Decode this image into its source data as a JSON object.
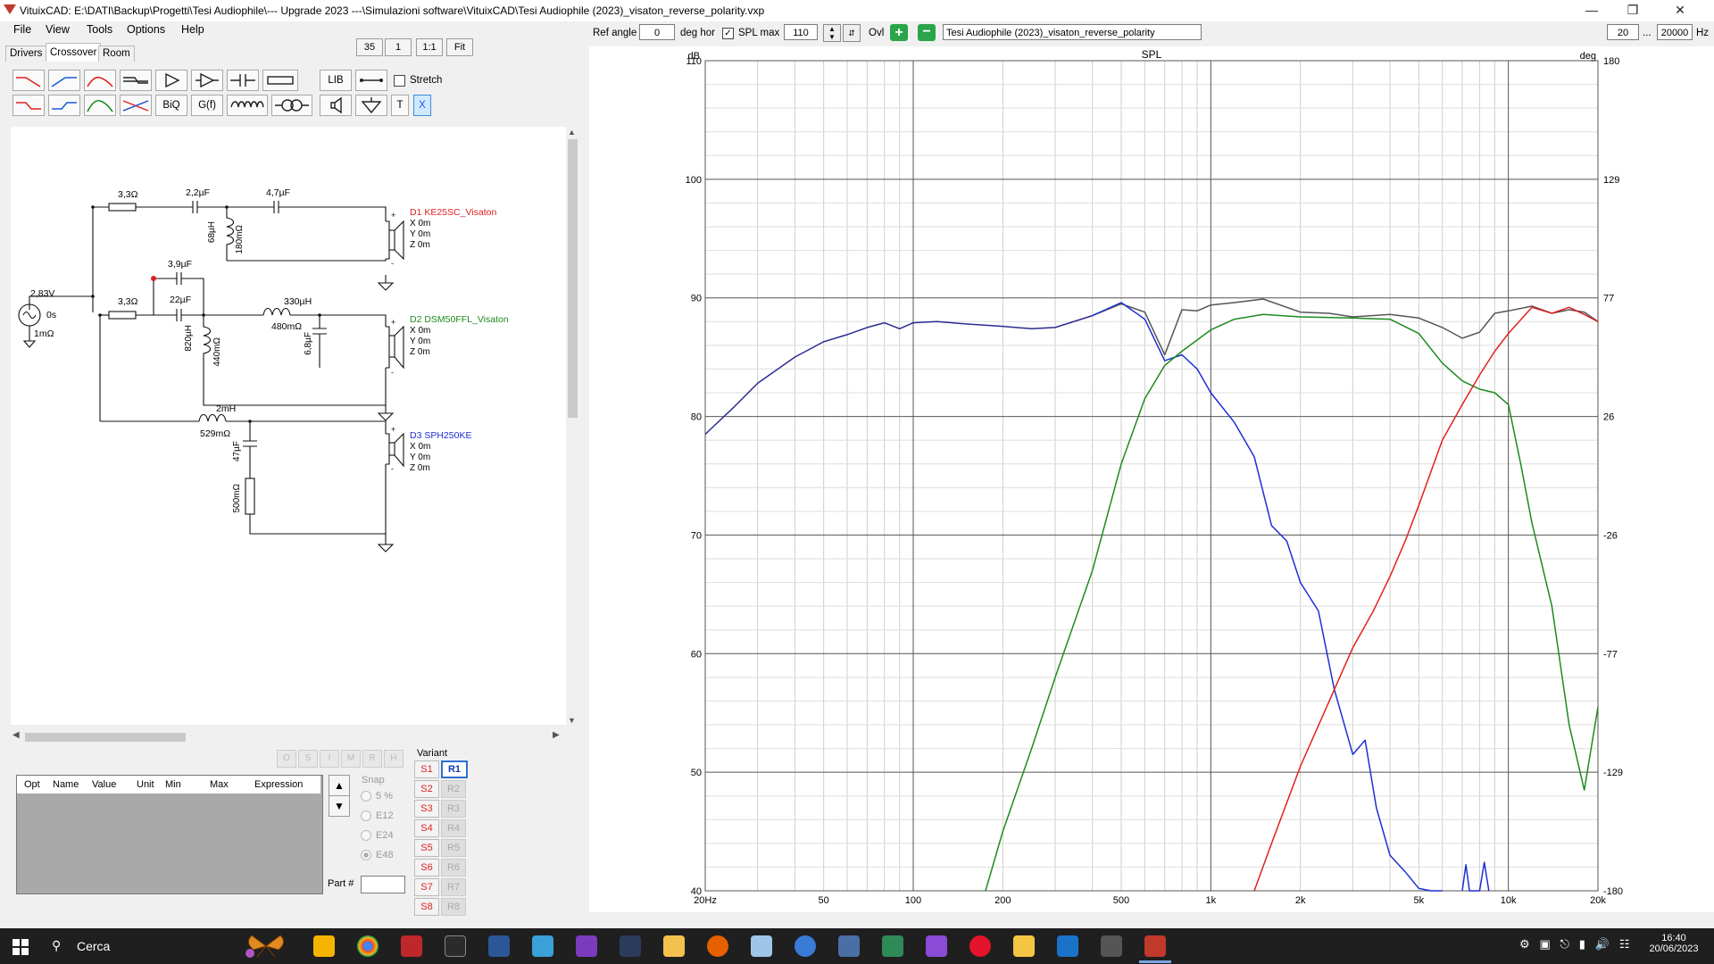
{
  "window": {
    "title": "VituixCAD: E:\\DATI\\Backup\\Progetti\\Tesi Audiophile\\--- Upgrade 2023 ---\\Simulazioni software\\VituixCAD\\Tesi Audiophile (2023)_visaton_reverse_polarity.vxp"
  },
  "menu": [
    "File",
    "View",
    "Tools",
    "Options",
    "Help"
  ],
  "tabs": [
    "Drivers",
    "Crossover",
    "Room"
  ],
  "toolbar": {
    "zoom_value": "35",
    "zoom_step": "1",
    "one_to_one": "1:1",
    "fit": "Fit",
    "lib_label": "LIB",
    "biq_label": "BiQ",
    "gf_label": "G(f)",
    "t_label": "T",
    "x_label": "X",
    "stretch_label": "Stretch"
  },
  "graph_toolbar": {
    "ref_angle_label": "Ref angle",
    "ref_angle_value": "0",
    "deg_hor_label": "deg hor",
    "spl_max_label": "SPL max",
    "spl_max_value": "110",
    "ovl_label": "Ovl",
    "overlay_name": "Tesi Audiophile (2023)_visaton_reverse_polarity",
    "freq_min": "20",
    "freq_sep": "...",
    "freq_max": "20000",
    "hz_label": "Hz"
  },
  "schematic": {
    "source": {
      "voltage": "2,83V",
      "delay": "0s",
      "impedance": "1mΩ"
    },
    "components": {
      "r_tw": "3,3Ω",
      "c_tw1": "2,2µF",
      "c_tw2": "4,7µF",
      "l_tw": "68µH",
      "r_ltw": "180mΩ",
      "c_mid_par": "3,9µF",
      "r_mid": "3,3Ω",
      "c_mid": "22µF",
      "l_mid_ser": "330µH",
      "r_lmid_ser": "480mΩ",
      "l_mid_sh": "820µH",
      "r_lmid_sh": "440mΩ",
      "c_mid_sh": "6,8µF",
      "l_woof": "2mH",
      "r_lwoof": "529mΩ",
      "c_woof": "47µF",
      "r_woof": "500mΩ"
    },
    "drivers": [
      {
        "name": "D1 KE25SC_Visaton",
        "x": "X 0m",
        "y": "Y 0m",
        "z": "Z 0m",
        "color": "#e02020"
      },
      {
        "name": "D2 DSM50FFL_Visaton",
        "x": "X 0m",
        "y": "Y 0m",
        "z": "Z 0m",
        "color": "#1e8a1e"
      },
      {
        "name": "D3 SPH250KE",
        "x": "X 0m",
        "y": "Y 0m",
        "z": "Z 0m",
        "color": "#1c2fd6"
      }
    ]
  },
  "bottom_panel": {
    "oh_buttons": [
      "O",
      "S",
      "I",
      "M",
      "R",
      "H"
    ],
    "columns": [
      "Opt",
      "Name",
      "Value",
      "Unit",
      "Min",
      "Max",
      "Expression"
    ],
    "snap_label": "Snap",
    "snap_options": [
      "5 %",
      "E12",
      "E24",
      "E48"
    ],
    "part_label": "Part #",
    "variant_label": "Variant",
    "variants_s": [
      "S1",
      "S2",
      "S3",
      "S4",
      "S5",
      "S6",
      "S7",
      "S8"
    ],
    "variants_r": [
      "R1",
      "R2",
      "R3",
      "R4",
      "R5",
      "R6",
      "R7",
      "R8"
    ]
  },
  "chart_data": {
    "type": "line",
    "title": "SPL",
    "ylabel": "dB",
    "ylabel_right": "deg",
    "xscale": "log",
    "xlim": [
      20,
      20000
    ],
    "ylim": [
      40,
      110
    ],
    "ylim_right": [
      -180,
      180
    ],
    "x_ticks": [
      "20Hz",
      "50",
      "100",
      "200",
      "500",
      "1k",
      "2k",
      "5k",
      "10k",
      "20k"
    ],
    "y_ticks": [
      "110",
      "100",
      "90",
      "80",
      "70",
      "60",
      "50",
      "40"
    ],
    "y_ticks_right": [
      "180",
      "129",
      "77",
      "26",
      "-26",
      "-77",
      "-129",
      "-180"
    ],
    "grid": true,
    "series": [
      {
        "color": "#2b2b8f",
        "x": [
          20,
          25,
          30,
          40,
          50,
          60,
          70,
          80,
          90,
          100,
          120,
          150,
          200,
          250,
          300,
          400
        ],
        "y": [
          78.5,
          80.8,
          82.8,
          85.0,
          86.3,
          86.9,
          87.5,
          87.9,
          87.4,
          87.9,
          88.0,
          87.8,
          87.6,
          87.4,
          87.5,
          88.5
        ]
      },
      {
        "color": "#555555",
        "x": [
          400,
          500,
          600,
          700,
          800,
          900,
          1000,
          1200,
          1500,
          2000,
          2500,
          3000,
          4000,
          5000,
          6000,
          7000,
          8000,
          9000,
          10000,
          12000,
          14000,
          16000,
          18000,
          20000
        ],
        "y": [
          88.5,
          89.5,
          88.8,
          85.2,
          89.0,
          88.9,
          89.4,
          89.6,
          89.9,
          88.8,
          88.7,
          88.4,
          88.6,
          88.3,
          87.5,
          86.6,
          87.1,
          88.7,
          88.9,
          89.3,
          88.7,
          89.0,
          88.8,
          88.0
        ]
      },
      {
        "color": "#1c2fd6",
        "x": [
          400,
          500,
          600,
          700,
          800,
          900,
          1000,
          1200,
          1400,
          1600,
          1800,
          2000,
          2300,
          2600,
          3000,
          3300,
          3600,
          4000,
          4500,
          5000,
          5500,
          6000
        ],
        "y": [
          88.5,
          89.6,
          88.2,
          84.7,
          85.2,
          84.0,
          82.0,
          79.5,
          76.6,
          70.8,
          69.5,
          66.0,
          63.6,
          57.0,
          51.5,
          52.7,
          47.0,
          43.0,
          41.6,
          40.2,
          40.0,
          40.0
        ]
      },
      {
        "color": "#1c2fd6",
        "x": [
          7000,
          7200,
          7400,
          8000,
          8300,
          8600
        ],
        "y": [
          40.0,
          42.2,
          40.0,
          40.0,
          42.4,
          40.0
        ]
      },
      {
        "color": "#1e8a1e",
        "x": [
          175,
          200,
          250,
          300,
          400,
          500,
          600,
          700,
          800,
          1000,
          1200,
          1500,
          2000,
          3000,
          4000,
          5000,
          6000,
          7000,
          8000,
          9000,
          10000,
          11000,
          12000,
          14000,
          16000,
          18000,
          20000
        ],
        "y": [
          40.0,
          45.0,
          52.0,
          58.0,
          67.0,
          76.0,
          81.5,
          84.3,
          85.5,
          87.3,
          88.2,
          88.6,
          88.4,
          88.3,
          88.2,
          87.0,
          84.5,
          83.0,
          82.3,
          82.0,
          81.0,
          76.0,
          71.0,
          64.0,
          54.0,
          48.5,
          55.5
        ]
      },
      {
        "color": "#e02020",
        "x": [
          1400,
          1600,
          2000,
          2500,
          3000,
          3500,
          4000,
          4500,
          5000,
          6000,
          7000,
          8000,
          9000,
          10000,
          12000,
          14000,
          16000,
          18000,
          20000
        ],
        "y": [
          40.0,
          44.0,
          50.5,
          56.0,
          60.5,
          63.5,
          66.5,
          69.5,
          72.5,
          78.0,
          81.0,
          83.5,
          85.5,
          87.0,
          89.2,
          88.7,
          89.2,
          88.6,
          88.0
        ]
      }
    ]
  },
  "taskbar": {
    "search_label": "Cerca",
    "time": "16:40",
    "date": "20/06/2023"
  },
  "colors": {
    "accent": "#2f6fd0",
    "tweeter": "#e02020",
    "mid": "#1e8a1e",
    "woofer": "#1c2fd6"
  }
}
